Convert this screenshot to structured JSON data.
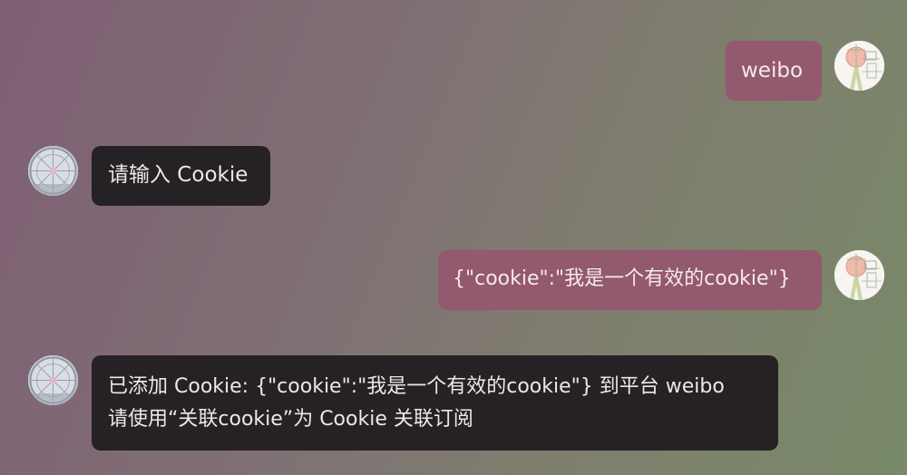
{
  "messages": [
    {
      "side": "right",
      "avatar": "user-avatar-icon",
      "text": "weibo"
    },
    {
      "side": "left",
      "avatar": "bot-avatar-icon",
      "text": "请输入 Cookie"
    },
    {
      "side": "right",
      "avatar": "user-avatar-icon",
      "text": "{\"cookie\":\"我是一个有效的cookie\"}"
    },
    {
      "side": "left",
      "avatar": "bot-avatar-icon",
      "text": "已添加 Cookie: {\"cookie\":\"我是一个有效的cookie\"} 到平台 weibo\n请使用“关联cookie”为 Cookie 关联订阅"
    }
  ],
  "colors": {
    "user_bubble": "#93596f",
    "bot_bubble": "#252124",
    "background_left": "#7f5f73",
    "background_right": "#788a68"
  }
}
